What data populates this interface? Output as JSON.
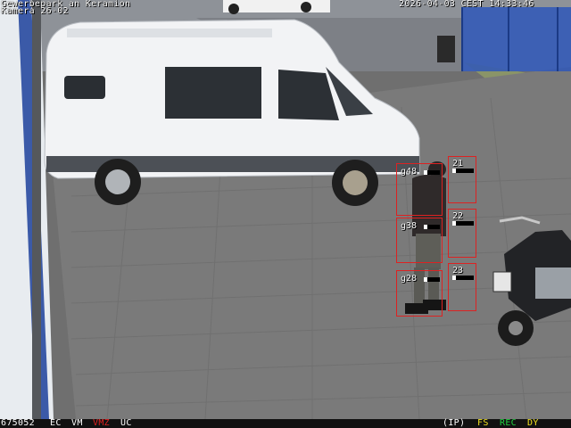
{
  "overlay": {
    "location_line": "Gewerbepark an Keramion",
    "camera_line": "Kamera 26-02",
    "timestamp": "2026-04-03 CEST 14:33:46"
  },
  "status_bar": {
    "frame_counter": "675052",
    "flags_left": [
      "EC",
      "VM"
    ],
    "flag_alert": "VMZ",
    "flag_uc": "UC",
    "ip": "(IP)",
    "fs": "FS",
    "rec": "REC",
    "dy": "DY"
  },
  "detections": {
    "person_zones": [
      {
        "label": "g48"
      },
      {
        "label": "g38"
      },
      {
        "label": "g28"
      }
    ],
    "side_zones": [
      {
        "label": "21"
      },
      {
        "label": "22"
      },
      {
        "label": "23"
      }
    ]
  },
  "colors": {
    "detection_box": "#d22222",
    "alert_flag": "#e02020",
    "fs_flag": "#f0e020",
    "rec_flag": "#20d040",
    "dy_flag": "#f0e020"
  }
}
